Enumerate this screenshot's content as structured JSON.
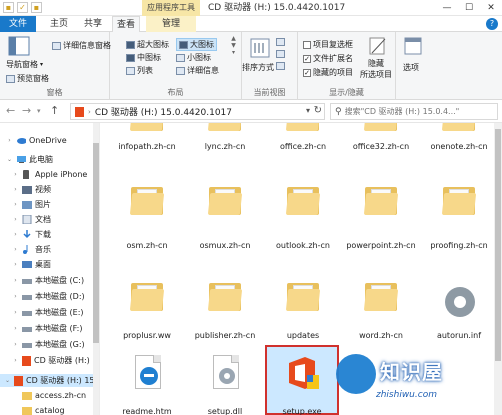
{
  "titlebar": {
    "context_tab": "应用程序工具",
    "title": "CD 驱动器 (H:) 15.0.4420.1017",
    "minimize": "—",
    "maximize": "☐",
    "close": "✕"
  },
  "tabs": {
    "file": "文件",
    "home": "主页",
    "share": "共享",
    "view": "查看",
    "manage": "管理",
    "help": "?"
  },
  "ribbon": {
    "panes": {
      "nav_pane": "导航窗格",
      "preview_pane": "预览窗格",
      "details_pane": "详细信息窗格",
      "label": "窗格"
    },
    "layout": {
      "extra_large": "超大图标",
      "large": "大图标",
      "medium": "中图标",
      "small": "小图标",
      "list": "列表",
      "details": "详细信息",
      "label": "布局"
    },
    "current_view": {
      "sort_by": "排序方式",
      "label": "当前视图"
    },
    "show_hide": {
      "item_checkboxes": "项目复选框",
      "file_extensions": "文件扩展名",
      "hidden_items": "隐藏的项目",
      "hide_selected": "隐藏",
      "hide_selected2": "所选项目",
      "label": "显示/隐藏"
    },
    "options": "选项"
  },
  "addressbar": {
    "path": "CD 驱动器 (H:) 15.0.4420.1017",
    "search_placeholder": "搜索\"CD 驱动器 (H:) 15.0.4...\""
  },
  "navpane": {
    "items": [
      {
        "label": "OneDrive"
      },
      {
        "label": "此电脑"
      },
      {
        "label": "Apple iPhone"
      },
      {
        "label": "视频"
      },
      {
        "label": "图片"
      },
      {
        "label": "文档"
      },
      {
        "label": "下载"
      },
      {
        "label": "音乐"
      },
      {
        "label": "桌面"
      },
      {
        "label": "本地磁盘 (C:)"
      },
      {
        "label": "本地磁盘 (D:)"
      },
      {
        "label": "本地磁盘 (E:)"
      },
      {
        "label": "本地磁盘 (F:)"
      },
      {
        "label": "本地磁盘 (G:)"
      },
      {
        "label": "CD 驱动器 (H:)"
      },
      {
        "label": "CD 驱动器 (H:) 15"
      },
      {
        "label": "access.zh-cn"
      },
      {
        "label": "catalog"
      }
    ]
  },
  "files": {
    "row1": [
      "infopath.zh-cn",
      "lync.zh-cn",
      "office.zh-cn",
      "office32.zh-cn",
      "onenote.zh-cn"
    ],
    "row2": [
      "osm.zh-cn",
      "osmux.zh-cn",
      "outlook.zh-cn",
      "powerpoint.zh-cn",
      "proofing.zh-cn"
    ],
    "row3": [
      "proplusr.ww",
      "publisher.zh-cn",
      "updates",
      "word.zh-cn",
      "autorun.inf"
    ],
    "row4": [
      "readme.htm",
      "setup.dll",
      "setup.exe",
      "",
      ""
    ]
  },
  "watermark": {
    "text": "知识屋",
    "url": "zhishiwu.com"
  },
  "colors": {
    "accent": "#1979ca",
    "folder": "#f7d88a",
    "office": "#e74a1c",
    "selection": "#cce8ff",
    "highlight_border": "#d0312d"
  }
}
